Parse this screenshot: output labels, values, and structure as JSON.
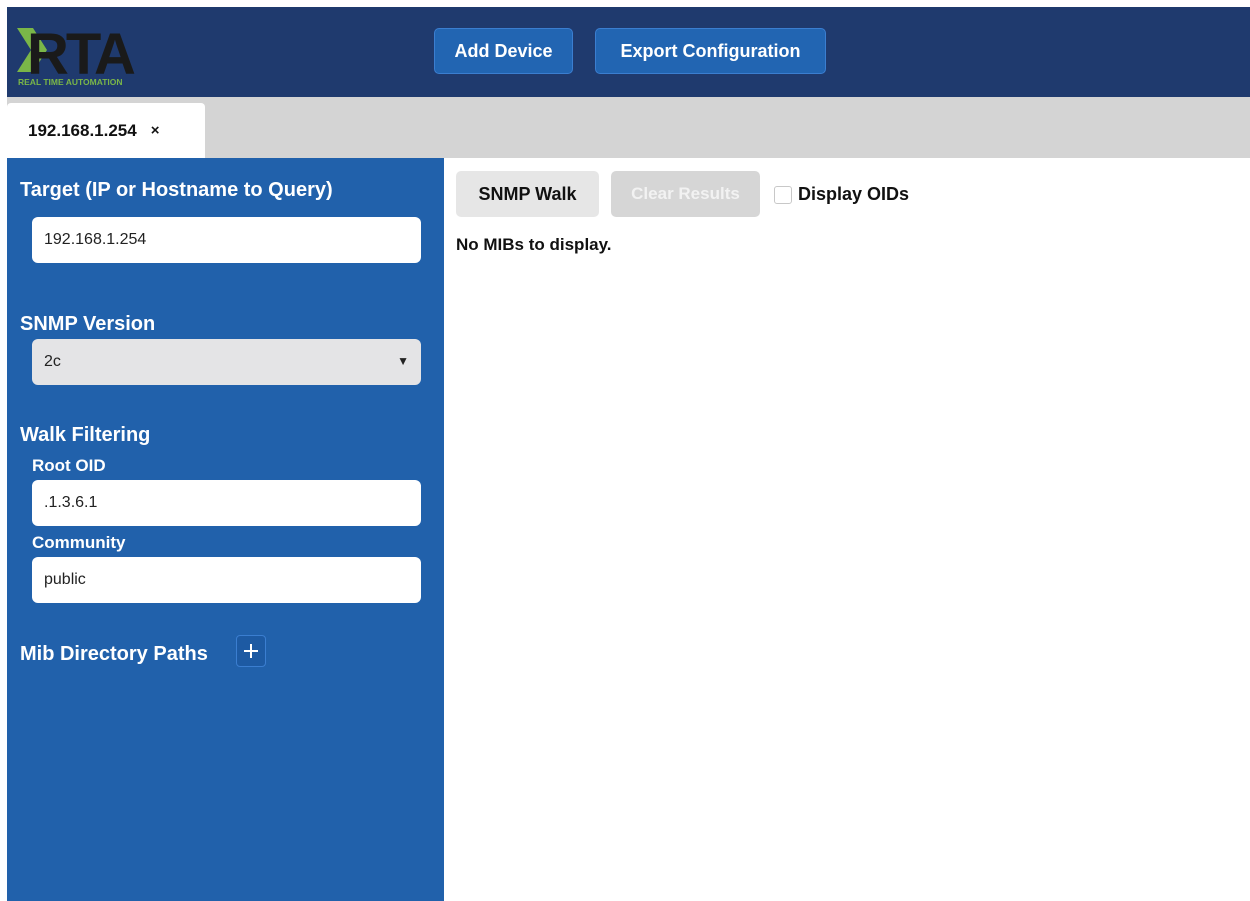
{
  "header": {
    "logo_text": "RTA",
    "logo_subtext": "REAL TIME AUTOMATION",
    "buttons": {
      "add_device": "Add Device",
      "export_configuration": "Export Configuration"
    }
  },
  "tabs": [
    {
      "label": "192.168.1.254",
      "close": "×"
    }
  ],
  "sidebar": {
    "target_heading": "Target (IP or Hostname to Query)",
    "target_value": "192.168.1.254",
    "snmp_version_heading": "SNMP Version",
    "snmp_version_value": "2c",
    "walk_filtering_heading": "Walk Filtering",
    "root_oid_label": "Root OID",
    "root_oid_value": ".1.3.6.1",
    "community_label": "Community",
    "community_value": "public",
    "mib_paths_heading": "Mib Directory Paths"
  },
  "main": {
    "snmp_walk_button": "SNMP Walk",
    "clear_results_button": "Clear Results",
    "display_oids_label": "Display OIDs",
    "display_oids_checked": false,
    "empty_message": "No MIBs to display."
  },
  "colors": {
    "header_bg": "#1f3a6e",
    "sidebar_bg": "#2161ab",
    "header_button_bg": "#2265b2",
    "logo_green": "#7ab648",
    "tabbar_bg": "#d4d4d4"
  },
  "icons": {
    "tab_close": "close-icon",
    "add_mib_path": "plus-icon",
    "select_caret": "caret-down-icon"
  }
}
